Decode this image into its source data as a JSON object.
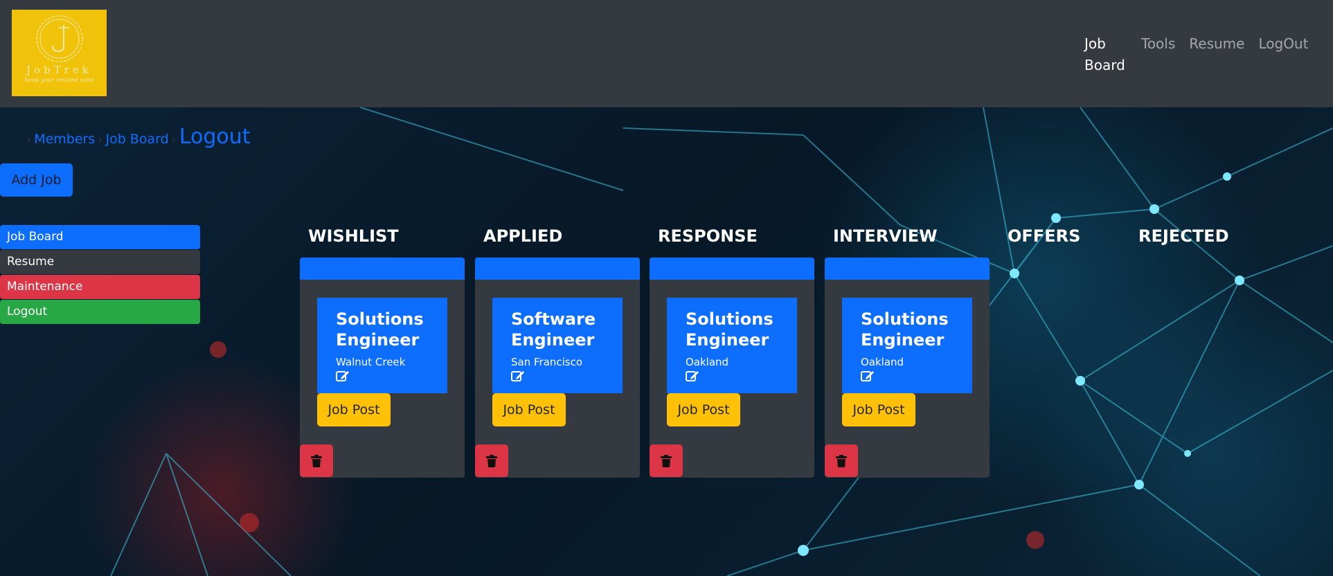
{
  "brand": {
    "name": "JobTrek",
    "tagline": "keep your resumé sane",
    "color": "#f0c30a"
  },
  "nav": {
    "links": [
      {
        "label": "Job Board",
        "active": true
      },
      {
        "label": "Tools",
        "active": false
      },
      {
        "label": "Resume",
        "active": false
      },
      {
        "label": "LogOut",
        "active": false
      }
    ]
  },
  "breadcrumb": [
    "Members",
    "Job Board",
    "Logout"
  ],
  "actions": {
    "add_job": "Add Job"
  },
  "sidebar": {
    "items": [
      {
        "label": "Job Board",
        "color": "#0d6efd"
      },
      {
        "label": "Resume",
        "color": "#343a40"
      },
      {
        "label": "Maintenance",
        "color": "#dc3545"
      },
      {
        "label": "Logout",
        "color": "#28a745"
      }
    ]
  },
  "columns": [
    {
      "title": "WISHLIST"
    },
    {
      "title": "APPLIED"
    },
    {
      "title": "RESPONSE"
    },
    {
      "title": "INTERVIEW"
    },
    {
      "title": "OFFERS"
    },
    {
      "title": "REJECTED"
    }
  ],
  "cards": [
    {
      "title": "Solutions Engineer",
      "location": "Walnut Creek",
      "button": "Job Post",
      "column": "WISHLIST"
    },
    {
      "title": "Software Engineer",
      "location": "San Francisco",
      "button": "Job Post",
      "column": "APPLIED"
    },
    {
      "title": "Solutions Engineer",
      "location": "Oakland",
      "button": "Job Post",
      "column": "RESPONSE"
    },
    {
      "title": "Solutions Engineer",
      "location": "Oakland",
      "button": "Job Post",
      "column": "INTERVIEW"
    }
  ],
  "icons": {
    "edit": "edit-icon",
    "delete": "trash-icon"
  },
  "colors": {
    "primary": "#0d6efd",
    "warning": "#ffc107",
    "danger": "#dc3545",
    "success": "#28a745",
    "dark": "#343a40"
  }
}
